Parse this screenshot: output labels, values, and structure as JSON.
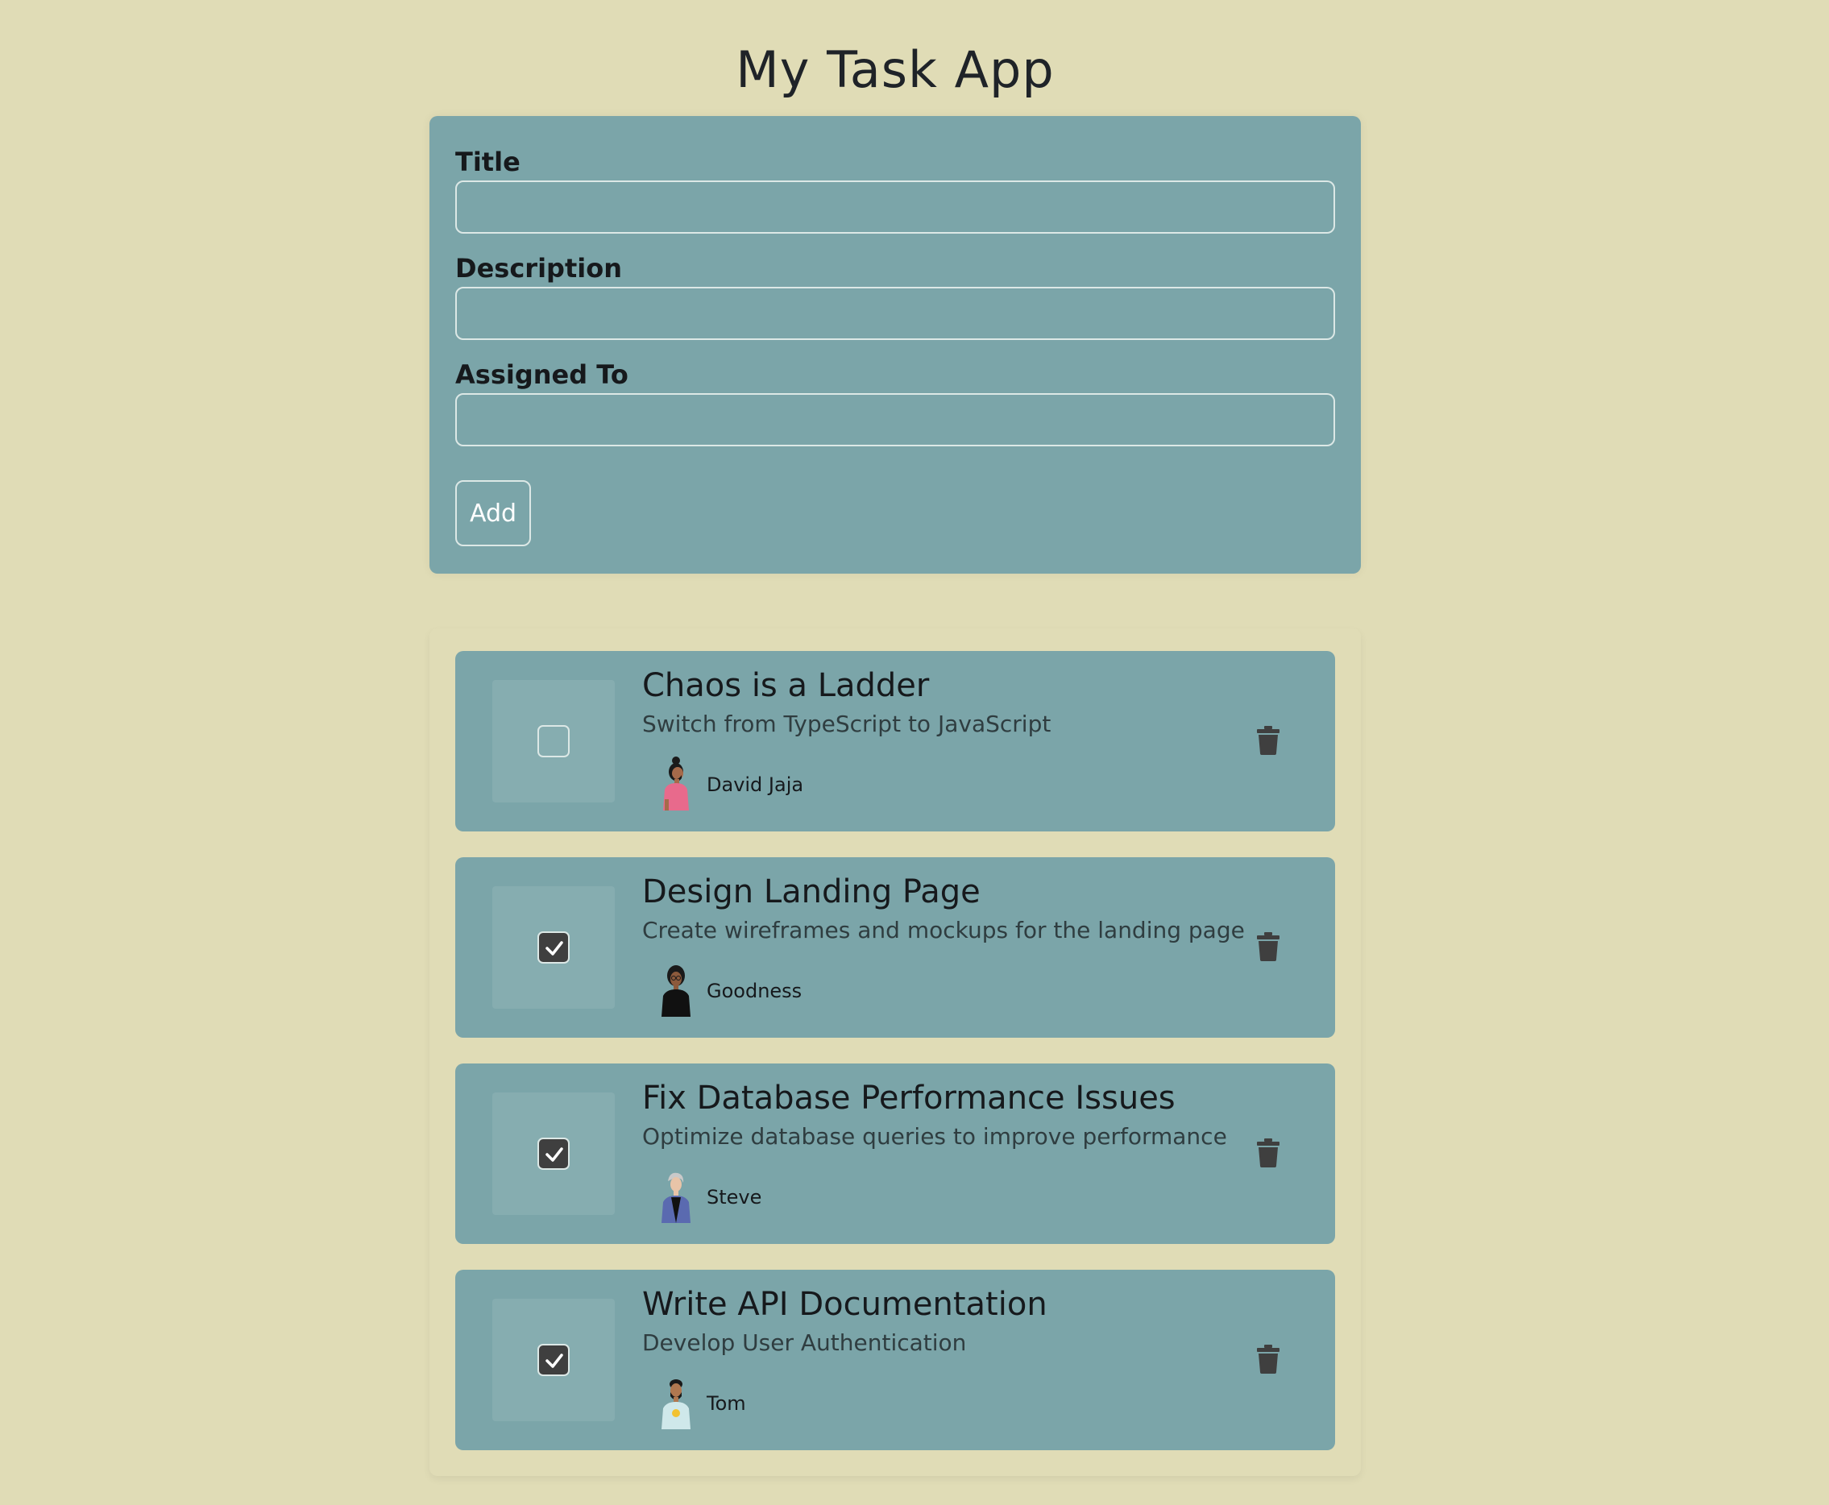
{
  "app": {
    "title": "My Task App"
  },
  "form": {
    "title_label": "Title",
    "title_value": "",
    "description_label": "Description",
    "description_value": "",
    "assigned_label": "Assigned To",
    "assigned_value": "",
    "add_label": "Add"
  },
  "tasks": [
    {
      "title": "Chaos is a Ladder",
      "description": "Switch from TypeScript to JavaScript",
      "assignee": "David Jaja",
      "completed": false
    },
    {
      "title": "Design Landing Page",
      "description": "Create wireframes and mockups for the landing page",
      "assignee": "Goodness",
      "completed": true
    },
    {
      "title": "Fix Database Performance Issues",
      "description": "Optimize database queries to improve performance",
      "assignee": "Steve",
      "completed": true
    },
    {
      "title": "Write API Documentation",
      "description": "Develop User Authentication",
      "assignee": "Tom",
      "completed": true
    }
  ],
  "icons": {
    "delete": "trash-icon",
    "check": "check-icon"
  },
  "colors": {
    "background": "#e0dcb6",
    "panel": "#7ba5a9",
    "checkbox_checked": "#3f3f3f",
    "trash": "#3f3f3f"
  }
}
